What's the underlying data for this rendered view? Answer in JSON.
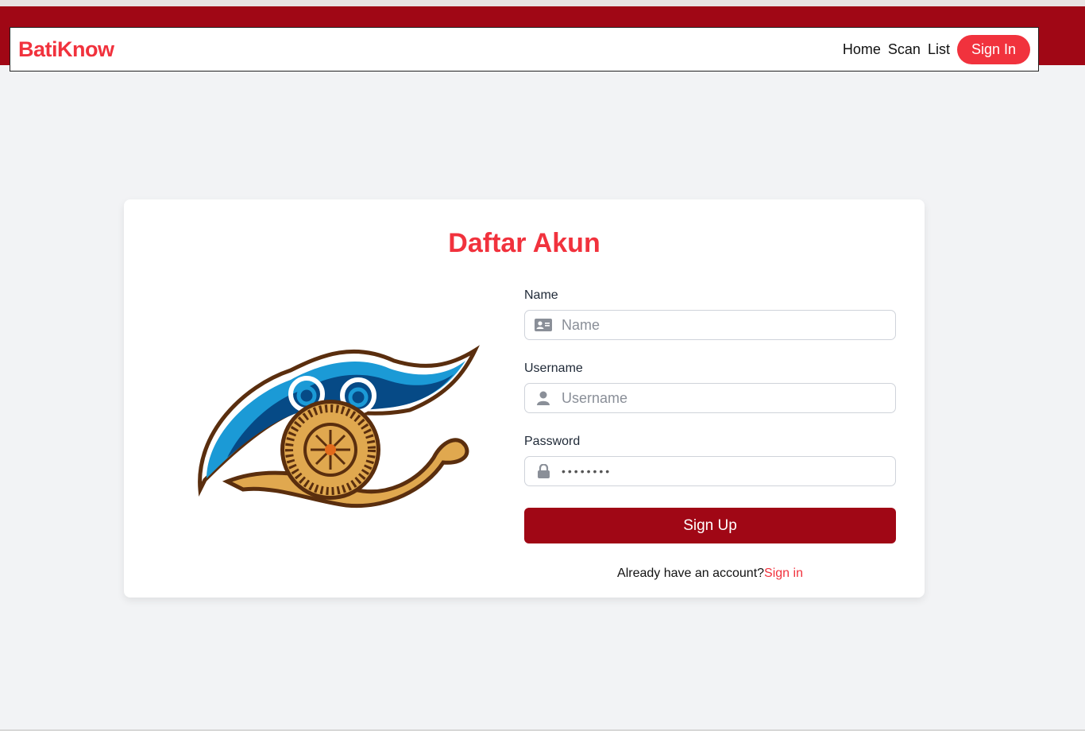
{
  "brand": "BatiKnow",
  "nav": {
    "links": [
      "Home",
      "Scan",
      "List"
    ],
    "signin_label": "Sign In"
  },
  "card": {
    "title": "Daftar Akun",
    "fields": {
      "name": {
        "label": "Name",
        "placeholder": "Name",
        "icon": "id-card-icon"
      },
      "username": {
        "label": "Username",
        "placeholder": "Username",
        "icon": "user-icon"
      },
      "password": {
        "label": "Password",
        "value": "••••••••",
        "icon": "lock-icon"
      }
    },
    "submit_label": "Sign Up",
    "already_text": "Already have an account?",
    "signin_link": "Sign in"
  },
  "colors": {
    "brand_red": "#f1323d",
    "dark_red": "#a00715",
    "page_bg": "#f2f3f5"
  }
}
